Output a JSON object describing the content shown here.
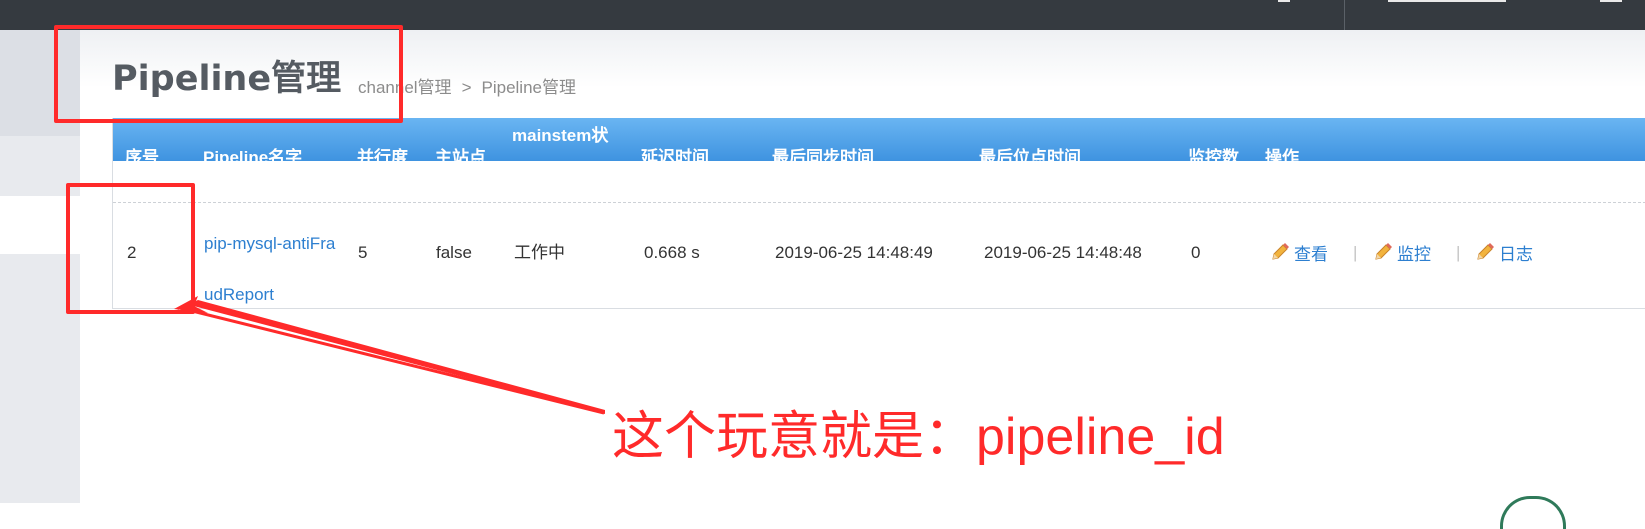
{
  "page": {
    "title": "Pipeline管理",
    "breadcrumb": {
      "parent": "channel管理",
      "separator": ">",
      "current": "Pipeline管理"
    }
  },
  "table": {
    "headers": {
      "index": "序号",
      "name": "Pipeline名字",
      "parallelism": "并行度",
      "main_site": "主站点",
      "mainstem_status": "mainstem状",
      "delay": "延迟时间",
      "last_sync_time": "最后同步时间",
      "last_position_time": "最后位点时间",
      "monitor_count": "监控数",
      "operations": "操作"
    },
    "rows": [
      {
        "index": "2",
        "name_line1": "pip-mysql-antiFra",
        "name_line2": "udReport",
        "parallelism": "5",
        "main_site": "false",
        "mainstem_status": "工作中",
        "delay": "0.668 s",
        "last_sync_time": "2019-06-25 14:48:49",
        "last_position_time": "2019-06-25 14:48:48",
        "monitor_count": "0",
        "actions": {
          "view": "查看",
          "monitor": "监控",
          "log": "日志",
          "separator": "|"
        }
      }
    ]
  },
  "annotation": {
    "text": "这个玩意就是：pipeline_id",
    "color": "#ff2a2a"
  },
  "colors": {
    "header_bg": "#3f93e0",
    "link": "#2d7fd0",
    "topbar": "#353a40"
  },
  "icons": {
    "action_icon": "pencil-icon"
  }
}
